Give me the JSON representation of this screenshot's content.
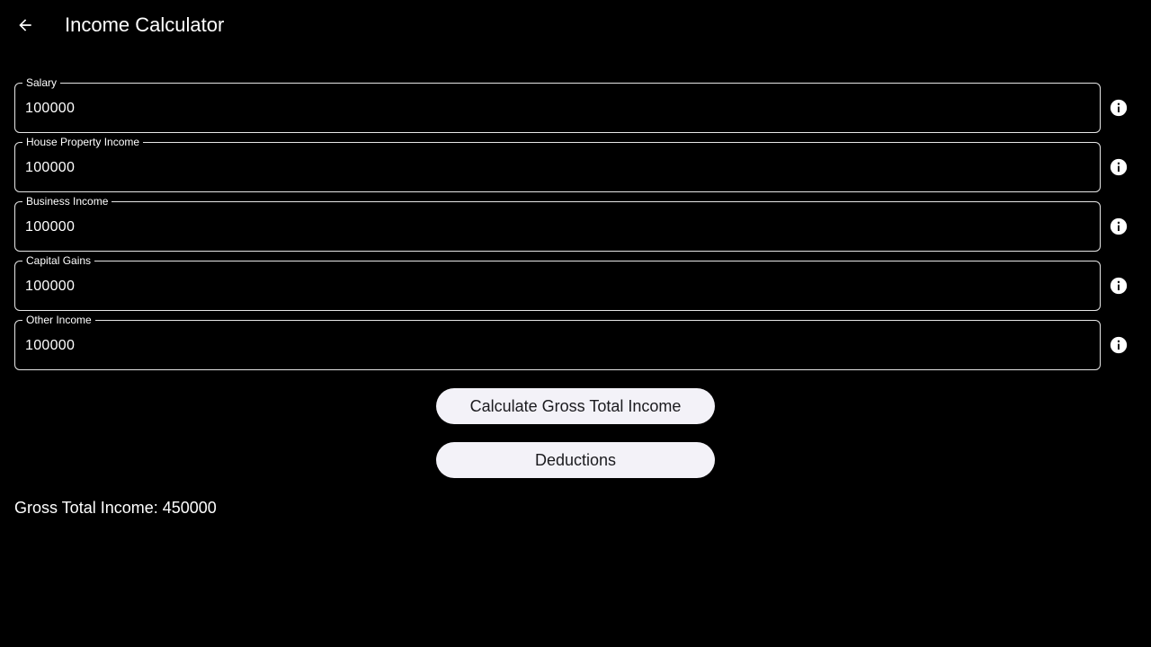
{
  "app_bar": {
    "title": "Income Calculator",
    "back_icon": "arrow-left-icon"
  },
  "fields": [
    {
      "label": "Salary",
      "value": "100000",
      "info_icon": "info-icon"
    },
    {
      "label": "House Property Income",
      "value": "100000",
      "info_icon": "info-icon"
    },
    {
      "label": "Business Income",
      "value": "100000",
      "info_icon": "info-icon"
    },
    {
      "label": "Capital Gains",
      "value": "100000",
      "info_icon": "info-icon"
    },
    {
      "label": "Other Income",
      "value": "100000",
      "info_icon": "info-icon"
    }
  ],
  "actions": {
    "calculate_label": "Calculate Gross Total Income",
    "deductions_label": "Deductions"
  },
  "result": {
    "text": "Gross Total Income: 450000"
  },
  "colors": {
    "background": "#000000",
    "text": "#ffffff",
    "button_bg": "#f3f2f8",
    "button_text": "#1b1b1f",
    "field_border": "#e6e6e6"
  }
}
